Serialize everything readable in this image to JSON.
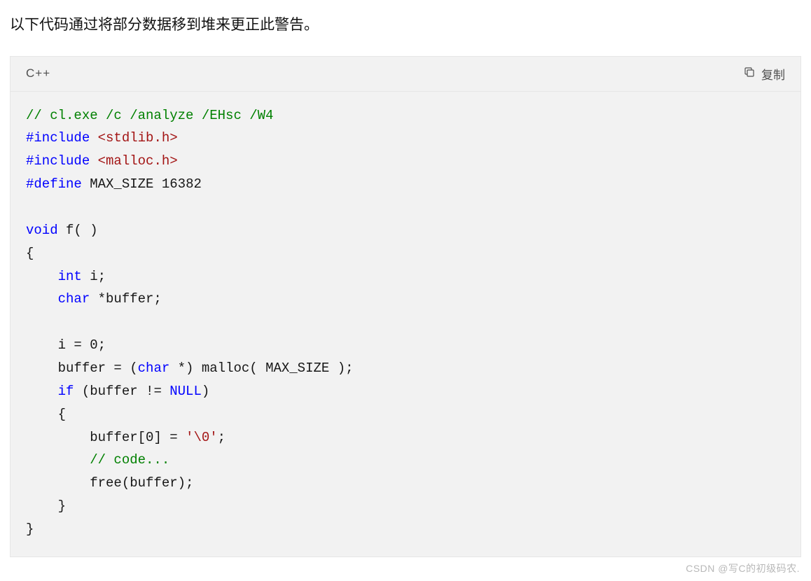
{
  "intro": "以下代码通过将部分数据移到堆来更正此警告。",
  "codeblock": {
    "language": "C++",
    "copy_label": "复制",
    "tokens": [
      [
        {
          "cls": "tok-comment",
          "t": "// cl.exe /c /analyze /EHsc /W4"
        }
      ],
      [
        {
          "cls": "tok-pp",
          "t": "#include"
        },
        {
          "cls": "tok-default",
          "t": " "
        },
        {
          "cls": "tok-str",
          "t": "<stdlib.h>"
        }
      ],
      [
        {
          "cls": "tok-pp",
          "t": "#include"
        },
        {
          "cls": "tok-default",
          "t": " "
        },
        {
          "cls": "tok-str",
          "t": "<malloc.h>"
        }
      ],
      [
        {
          "cls": "tok-pp",
          "t": "#define"
        },
        {
          "cls": "tok-default",
          "t": " MAX_SIZE "
        },
        {
          "cls": "tok-num",
          "t": "16382"
        }
      ],
      [],
      [
        {
          "cls": "tok-kw",
          "t": "void"
        },
        {
          "cls": "tok-default",
          "t": " f( )"
        }
      ],
      [
        {
          "cls": "tok-default",
          "t": "{"
        }
      ],
      [
        {
          "cls": "tok-default",
          "t": "    "
        },
        {
          "cls": "tok-kw",
          "t": "int"
        },
        {
          "cls": "tok-default",
          "t": " i;"
        }
      ],
      [
        {
          "cls": "tok-default",
          "t": "    "
        },
        {
          "cls": "tok-kw",
          "t": "char"
        },
        {
          "cls": "tok-default",
          "t": " *buffer;"
        }
      ],
      [],
      [
        {
          "cls": "tok-default",
          "t": "    i = "
        },
        {
          "cls": "tok-num",
          "t": "0"
        },
        {
          "cls": "tok-default",
          "t": ";"
        }
      ],
      [
        {
          "cls": "tok-default",
          "t": "    buffer = ("
        },
        {
          "cls": "tok-kw",
          "t": "char"
        },
        {
          "cls": "tok-default",
          "t": " *) malloc( MAX_SIZE );"
        }
      ],
      [
        {
          "cls": "tok-default",
          "t": "    "
        },
        {
          "cls": "tok-kw",
          "t": "if"
        },
        {
          "cls": "tok-default",
          "t": " (buffer != "
        },
        {
          "cls": "tok-kw",
          "t": "NULL"
        },
        {
          "cls": "tok-default",
          "t": ")"
        }
      ],
      [
        {
          "cls": "tok-default",
          "t": "    {"
        }
      ],
      [
        {
          "cls": "tok-default",
          "t": "        buffer["
        },
        {
          "cls": "tok-num",
          "t": "0"
        },
        {
          "cls": "tok-default",
          "t": "] = "
        },
        {
          "cls": "tok-str",
          "t": "'\\0'"
        },
        {
          "cls": "tok-default",
          "t": ";"
        }
      ],
      [
        {
          "cls": "tok-default",
          "t": "        "
        },
        {
          "cls": "tok-comment",
          "t": "// code..."
        }
      ],
      [
        {
          "cls": "tok-default",
          "t": "        free(buffer);"
        }
      ],
      [
        {
          "cls": "tok-default",
          "t": "    }"
        }
      ],
      [
        {
          "cls": "tok-default",
          "t": "}"
        }
      ]
    ]
  },
  "watermark": "CSDN @写C的初级码农."
}
